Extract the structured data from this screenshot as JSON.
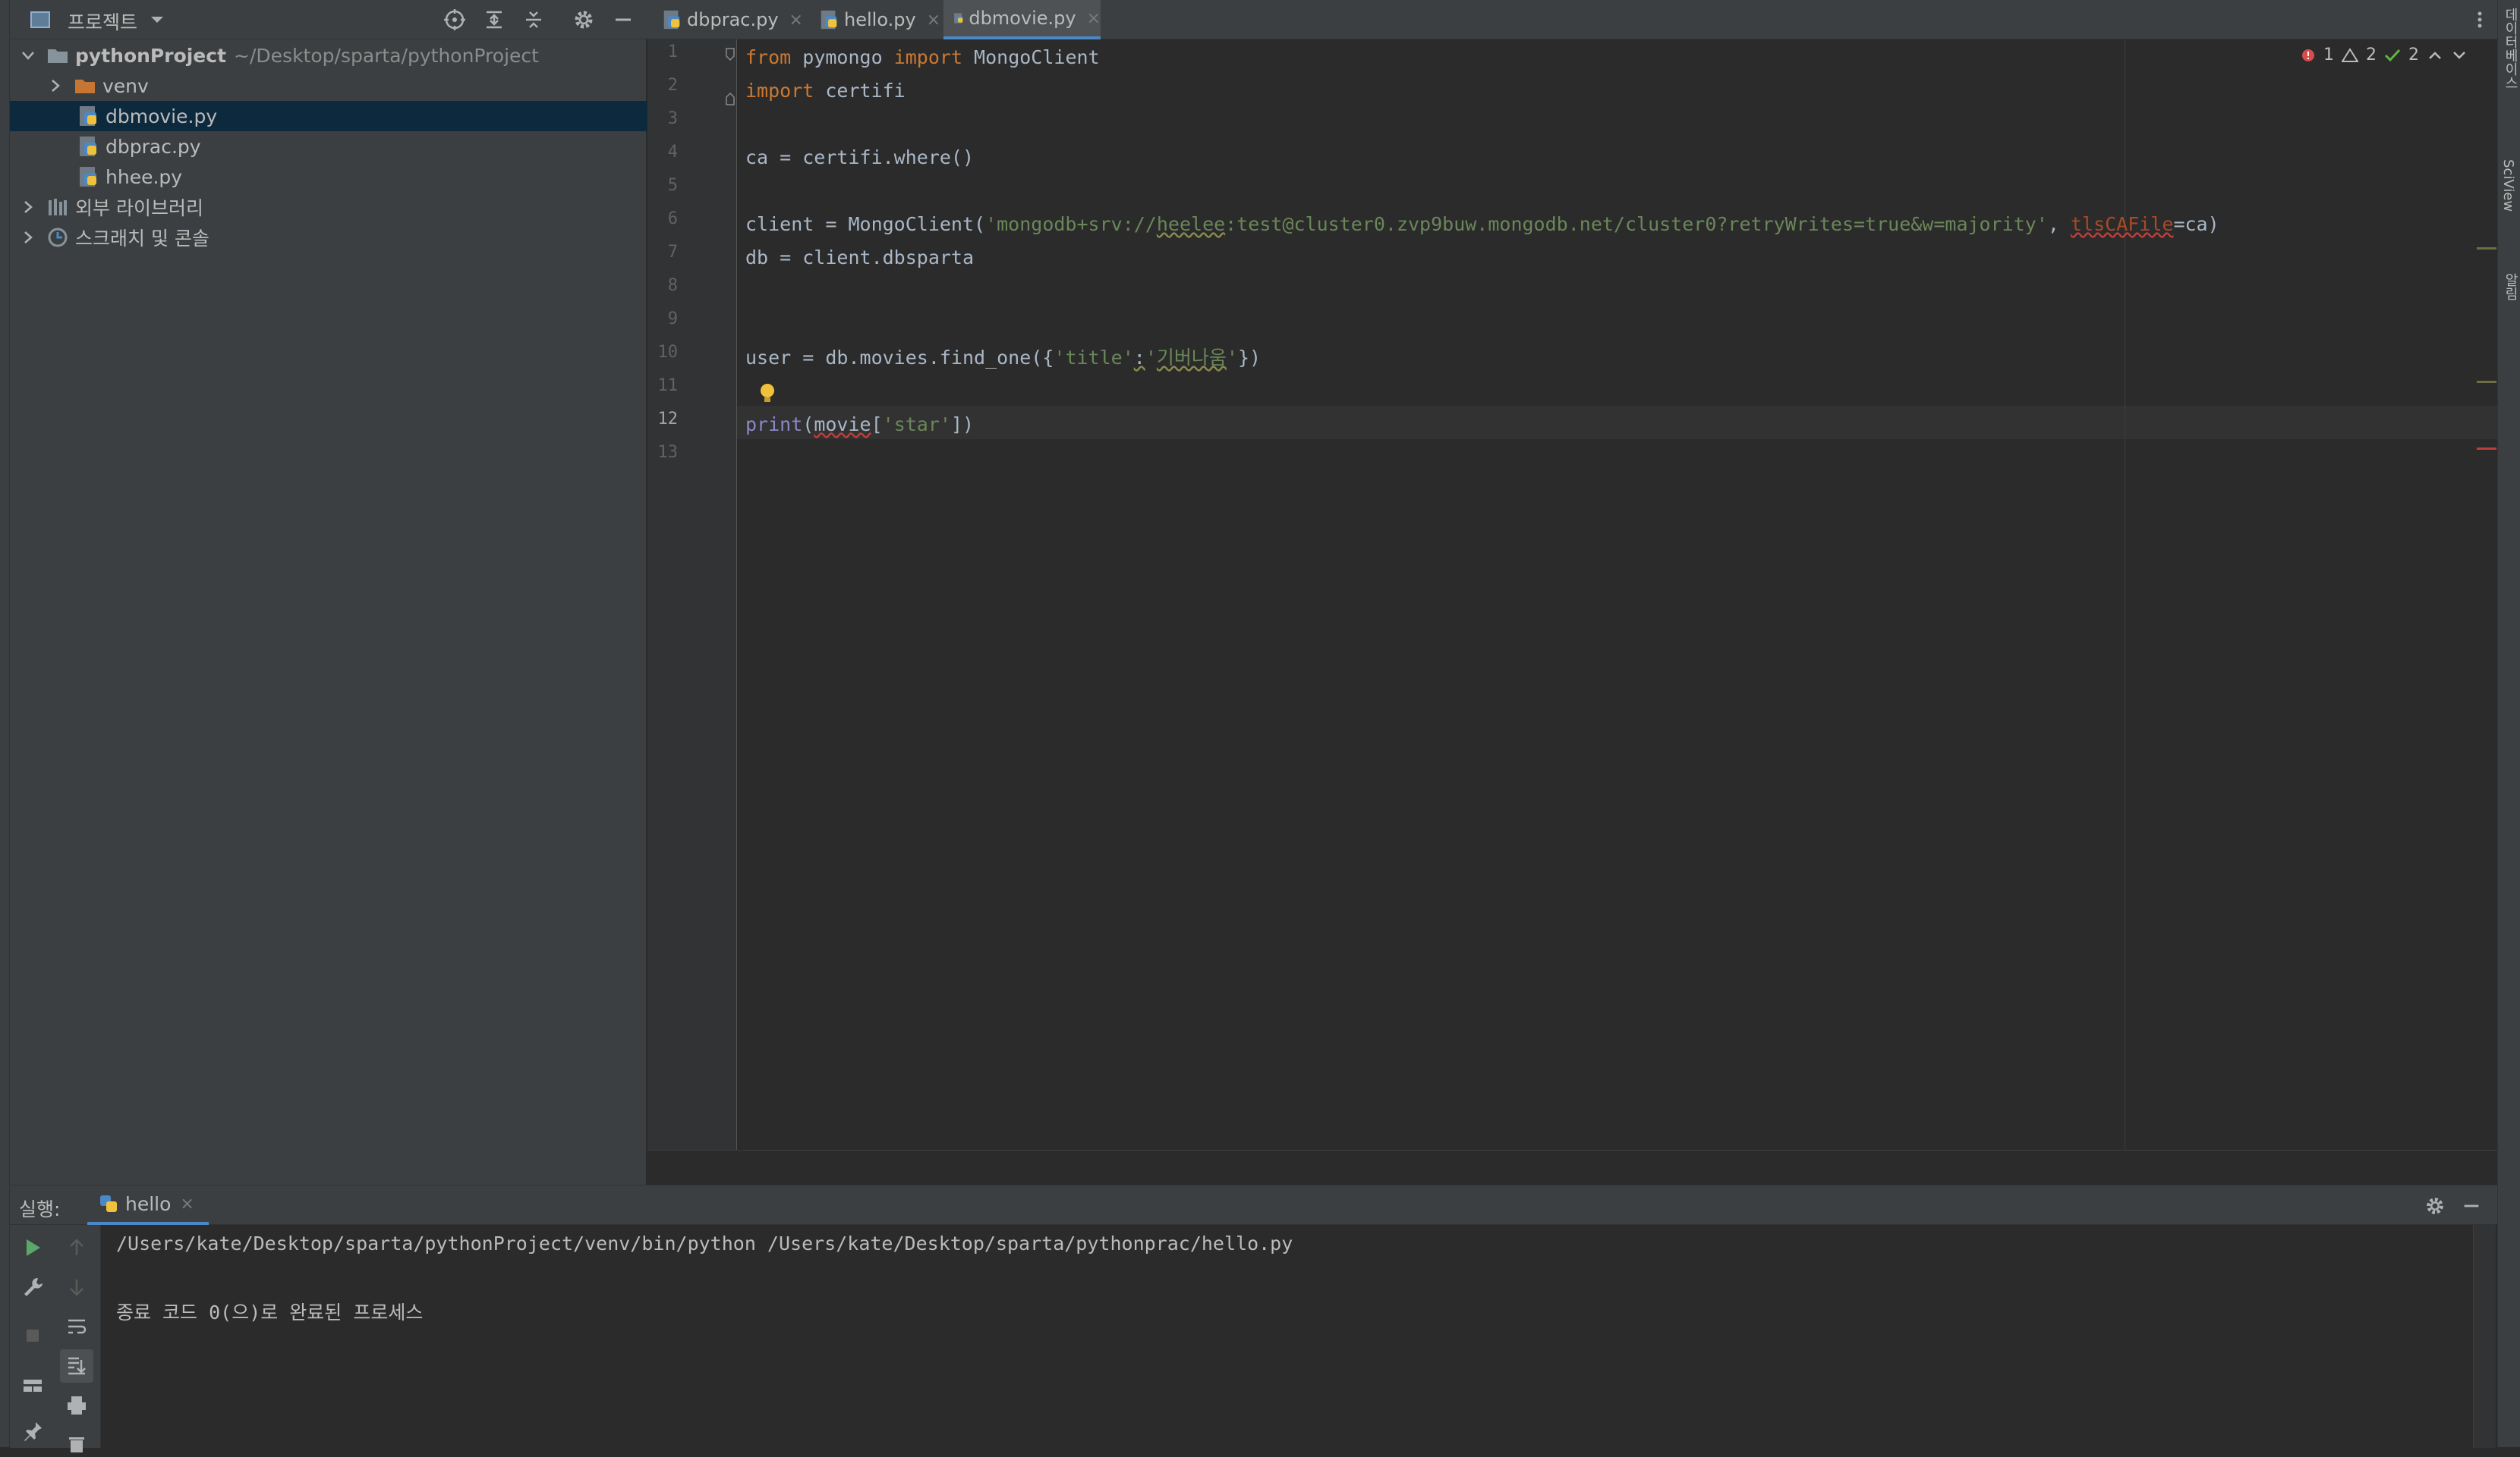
{
  "project_panel": {
    "title": "프로젝트",
    "tree": [
      {
        "name": "pythonProject",
        "path": "~/Desktop/sparta/pythonProject"
      },
      {
        "name": "venv"
      },
      {
        "name": "dbmovie.py"
      },
      {
        "name": "dbprac.py"
      },
      {
        "name": "hhee.py"
      },
      {
        "name": "외부 라이브러리"
      },
      {
        "name": "스크래치 및 콘솔"
      }
    ]
  },
  "editor": {
    "tabs": [
      {
        "label": "dbprac.py",
        "close": "×"
      },
      {
        "label": "hello.py",
        "close": "×"
      },
      {
        "label": "dbmovie.py",
        "close": "×"
      }
    ],
    "active_tab": "dbmovie.py",
    "current_line": "12",
    "line_numbers": [
      "1",
      "2",
      "3",
      "4",
      "5",
      "6",
      "7",
      "8",
      "9",
      "10",
      "11",
      "12",
      "13"
    ],
    "code": {
      "l1_kw1": "from",
      "l1_a": " pymongo ",
      "l1_kw2": "import",
      "l1_b": " MongoClient",
      "l2_kw": "import",
      "l2_a": " certifi",
      "l4": "ca = certifi.where()",
      "l6_a": "client = MongoClient(",
      "l6_s1": "'mongodb+srv://",
      "l6_s2": "heelee",
      "l6_s3": ":test@cluster0.zvp9buw.mongodb.net/cluster0?retryWrites=true&w=majority'",
      "l6_b": ", ",
      "l6_param": "tlsCAFile",
      "l6_c": "=ca)",
      "l7": "db = client.dbsparta",
      "l10_a": "user = db.movies.find_one({",
      "l10_s1": "'title'",
      "l10_colon": ":",
      "l10_s2": "'",
      "l10_s3": "기버나움",
      "l10_s4": "'",
      "l10_b": "})",
      "l12_fn": "print",
      "l12_a": "(",
      "l12_var": "movie",
      "l12_b": "[",
      "l12_s": "'star'",
      "l12_c": "])"
    },
    "inspections": {
      "errors": "1",
      "warnings": "2",
      "ok": "2"
    }
  },
  "right_strip": {
    "item1": "데이터베이스",
    "item2": "SciView",
    "item3": "알림"
  },
  "run_panel": {
    "label": "실행:",
    "tab": "hello",
    "tab_close": "×",
    "output_line1": "/Users/kate/Desktop/sparta/pythonProject/venv/bin/python /Users/kate/Desktop/sparta/pythonprac/hello.py",
    "output_line2": "종료 코드 0(으)로 완료된 프로세스"
  },
  "colors": {
    "keyword": "#cc7832",
    "string": "#6a8759",
    "selection": "#0d293e",
    "accent": "#4a88c7"
  }
}
